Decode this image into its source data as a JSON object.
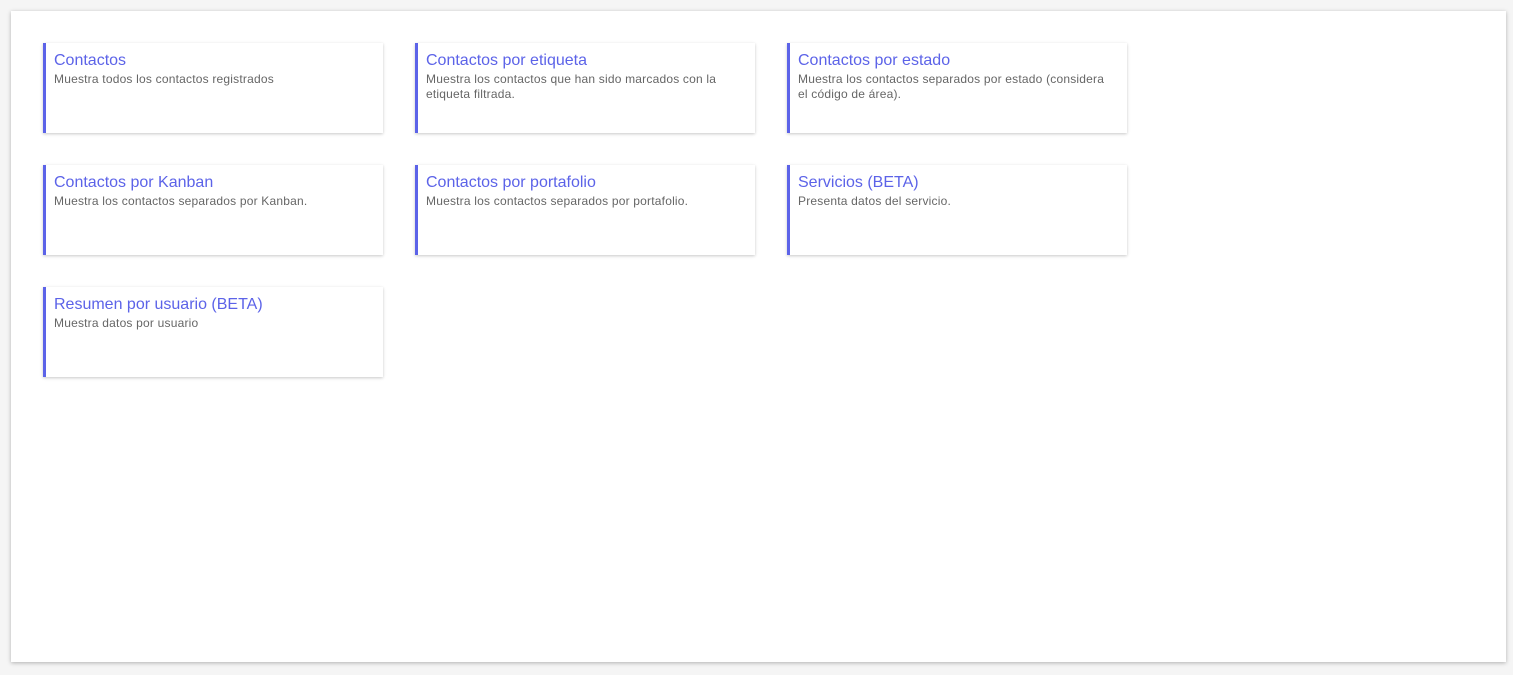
{
  "colors": {
    "accent": "#5c63e8",
    "text_secondary": "#666666",
    "background": "#f5f5f5",
    "card": "#ffffff"
  },
  "reports": [
    {
      "title": "Contactos",
      "description": "Muestra todos los contactos registrados"
    },
    {
      "title": "Contactos por etiqueta",
      "description": "Muestra los contactos que han sido marcados con la etiqueta filtrada."
    },
    {
      "title": "Contactos por estado",
      "description": "Muestra los contactos separados por estado (considera el código de área)."
    },
    {
      "title": "Contactos por Kanban",
      "description": "Muestra los contactos separados por Kanban."
    },
    {
      "title": "Contactos por portafolio",
      "description": "Muestra los contactos separados por portafolio."
    },
    {
      "title": "Servicios (BETA)",
      "description": "Presenta datos del servicio."
    },
    {
      "title": "Resumen por usuario (BETA)",
      "description": "Muestra datos por usuario"
    }
  ]
}
